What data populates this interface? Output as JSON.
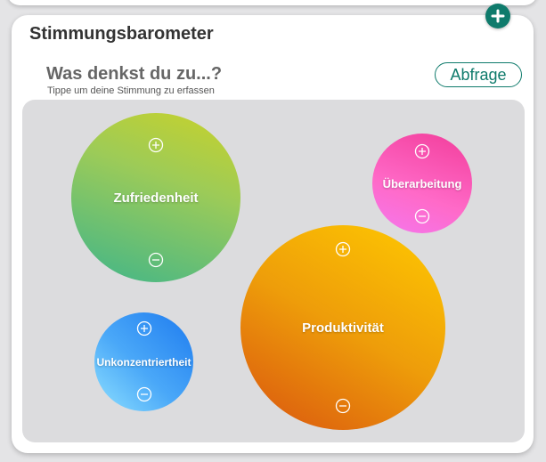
{
  "widget": {
    "title": "Stimmungsbarometer",
    "question": "Was denkst du zu...?",
    "hint": "Tippe um deine Stimmung zu erfassen",
    "poll_button": "Abfrage",
    "accent_color": "#0f7b6c",
    "add_icon": "plus-circle-icon"
  },
  "moods": [
    {
      "label": "Zufriedenheit",
      "colors": [
        "#c9d22a",
        "#3fb58a"
      ],
      "increase_icon": "plus-circle-icon",
      "decrease_icon": "minus-circle-icon"
    },
    {
      "label": "Überarbeitung",
      "colors": [
        "#f23d9a",
        "#f477ee"
      ],
      "increase_icon": "plus-circle-icon",
      "decrease_icon": "minus-circle-icon"
    },
    {
      "label": "Produktivität",
      "colors": [
        "#ffca00",
        "#d9540f"
      ],
      "increase_icon": "plus-circle-icon",
      "decrease_icon": "minus-circle-icon"
    },
    {
      "label": "Unkonzentriertheit",
      "colors": [
        "#1e7bef",
        "#8ee0ff"
      ],
      "increase_icon": "plus-circle-icon",
      "decrease_icon": "minus-circle-icon"
    }
  ]
}
